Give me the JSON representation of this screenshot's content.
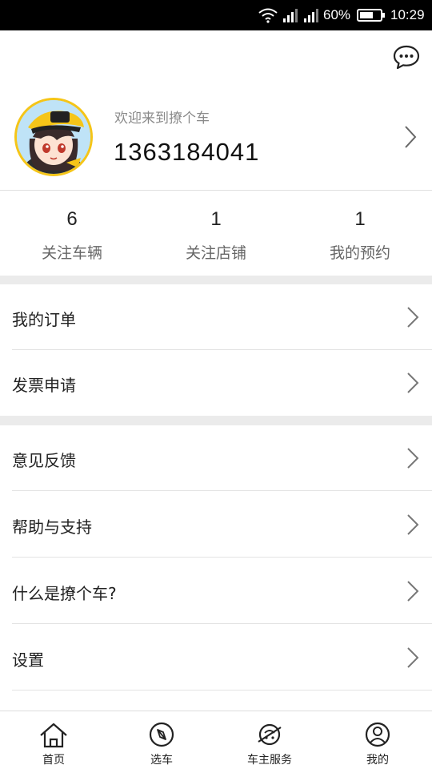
{
  "status_bar": {
    "battery_percent": "60%",
    "time": "10:29"
  },
  "header": {
    "message_icon": "chat-bubble-icon"
  },
  "profile": {
    "welcome": "欢迎来到撩个车",
    "phone": "1363184041",
    "avatar_icon": "avatar-cartoon-girl"
  },
  "stats": [
    {
      "value": "6",
      "label": "关注车辆"
    },
    {
      "value": "1",
      "label": "关注店铺"
    },
    {
      "value": "1",
      "label": "我的预约"
    }
  ],
  "menu_group_1": [
    {
      "label": "我的订单"
    },
    {
      "label": "发票申请"
    }
  ],
  "menu_group_2": [
    {
      "label": "意见反馈"
    },
    {
      "label": "帮助与支持"
    },
    {
      "label": "什么是撩个车?"
    },
    {
      "label": "设置"
    }
  ],
  "tabbar": [
    {
      "label": "首页",
      "icon": "home-icon"
    },
    {
      "label": "选车",
      "icon": "compass-icon"
    },
    {
      "label": "车主服务",
      "icon": "service-icon"
    },
    {
      "label": "我的",
      "icon": "user-icon"
    }
  ]
}
